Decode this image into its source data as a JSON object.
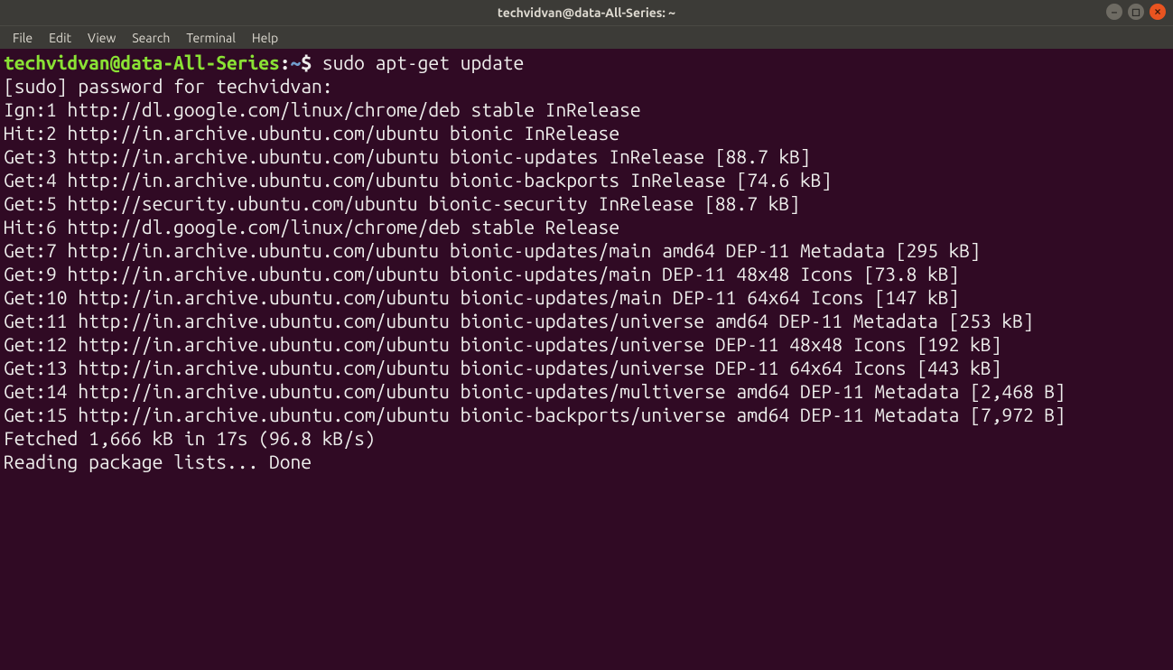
{
  "titlebar": {
    "title": "techvidvan@data-All-Series: ~"
  },
  "menu": {
    "file": "File",
    "edit": "Edit",
    "view": "View",
    "search": "Search",
    "terminal": "Terminal",
    "help": "Help"
  },
  "prompt": {
    "userhost": "techvidvan@data-All-Series",
    "colon": ":",
    "path": "~",
    "dollar": "$ ",
    "command": "sudo apt-get update"
  },
  "lines": [
    "[sudo] password for techvidvan:",
    "Ign:1 http://dl.google.com/linux/chrome/deb stable InRelease",
    "Hit:2 http://in.archive.ubuntu.com/ubuntu bionic InRelease",
    "Get:3 http://in.archive.ubuntu.com/ubuntu bionic-updates InRelease [88.7 kB]",
    "Get:4 http://in.archive.ubuntu.com/ubuntu bionic-backports InRelease [74.6 kB]",
    "Get:5 http://security.ubuntu.com/ubuntu bionic-security InRelease [88.7 kB]",
    "Hit:6 http://dl.google.com/linux/chrome/deb stable Release",
    "Get:7 http://in.archive.ubuntu.com/ubuntu bionic-updates/main amd64 DEP-11 Metadata [295 kB]",
    "Get:9 http://in.archive.ubuntu.com/ubuntu bionic-updates/main DEP-11 48x48 Icons [73.8 kB]",
    "Get:10 http://in.archive.ubuntu.com/ubuntu bionic-updates/main DEP-11 64x64 Icons [147 kB]",
    "Get:11 http://in.archive.ubuntu.com/ubuntu bionic-updates/universe amd64 DEP-11 Metadata [253 kB]",
    "Get:12 http://in.archive.ubuntu.com/ubuntu bionic-updates/universe DEP-11 48x48 Icons [192 kB]",
    "Get:13 http://in.archive.ubuntu.com/ubuntu bionic-updates/universe DEP-11 64x64 Icons [443 kB]",
    "Get:14 http://in.archive.ubuntu.com/ubuntu bionic-updates/multiverse amd64 DEP-11 Metadata [2,468 B]",
    "Get:15 http://in.archive.ubuntu.com/ubuntu bionic-backports/universe amd64 DEP-11 Metadata [7,972 B]",
    "Fetched 1,666 kB in 17s (96.8 kB/s)",
    "Reading package lists... Done"
  ]
}
